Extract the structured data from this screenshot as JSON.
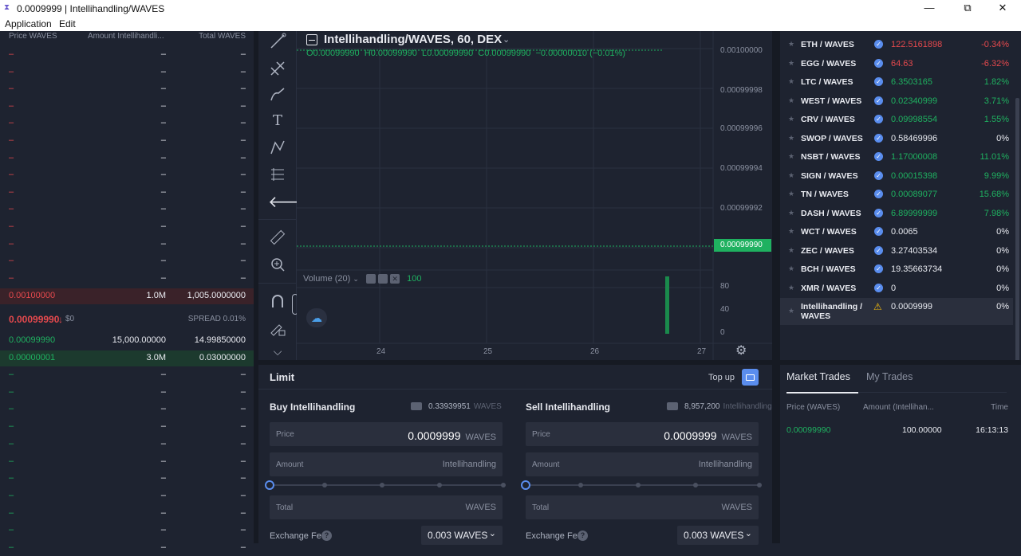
{
  "window": {
    "title": "0.0009999 | Intellihandling/WAVES",
    "logo_icon": "waves-logo-icon",
    "minimize": "—",
    "maximize": "⧉",
    "close": "✕"
  },
  "menu": [
    "Application",
    "Edit"
  ],
  "orderbook": {
    "headers": [
      "Price WAVES",
      "Amount Intellihandli...",
      "Total WAVES"
    ],
    "asks_empty": [
      "–",
      "–",
      "–",
      "–",
      "–",
      "–",
      "–",
      "–",
      "–",
      "–",
      "–",
      "–",
      "–",
      "–"
    ],
    "ask": {
      "price": "0.00100000",
      "amount": "1.0M",
      "total": "1,005.0000000"
    },
    "last": {
      "price": "0.00099990",
      "arrow": "↓",
      "usd": "$0",
      "spread": "SPREAD 0.01%"
    },
    "bids": [
      {
        "price": "0.00099990",
        "amount": "15,000.00000",
        "total": "14.99850000"
      },
      {
        "price": "0.00000001",
        "amount": "3.0M",
        "total": "0.03000000"
      }
    ],
    "bids_empty": [
      "–",
      "–",
      "–",
      "–",
      "–",
      "–",
      "–",
      "–",
      "–",
      "–",
      "–"
    ]
  },
  "chart": {
    "title": "Intellihandling/WAVES, 60, DEX",
    "ohlc": "O0.00099990  H0.00099990  L0.00099990  C0.00099990  −0.00000010 (−0.01%)",
    "y_ticks": [
      "0.00100000",
      "0.00099998",
      "0.00099996",
      "0.00099994",
      "0.00099992"
    ],
    "last_price_tag": "0.00099990",
    "volume_label": "Volume (20)",
    "volume_value": "100",
    "vol_ticks": [
      "80",
      "40",
      "0"
    ],
    "x_ticks": [
      "24",
      "25",
      "26",
      "27"
    ],
    "colors": {
      "up": "#1fb160",
      "tag": "#1fb160"
    }
  },
  "markets": [
    {
      "pair": "ETH / WAVES",
      "price": "122.5161898",
      "change": "-0.34%",
      "pc": "red",
      "cc": "red"
    },
    {
      "pair": "EGG / WAVES",
      "price": "64.63",
      "change": "-6.32%",
      "pc": "red",
      "cc": "red"
    },
    {
      "pair": "LTC / WAVES",
      "price": "6.3503165",
      "change": "1.82%",
      "pc": "grn",
      "cc": "grn"
    },
    {
      "pair": "WEST / WAVES",
      "price": "0.02340999",
      "change": "3.71%",
      "pc": "grn",
      "cc": "grn"
    },
    {
      "pair": "CRV / WAVES",
      "price": "0.09998554",
      "change": "1.55%",
      "pc": "grn",
      "cc": "grn"
    },
    {
      "pair": "SWOP / WAVES",
      "price": "0.58469996",
      "change": "0%",
      "pc": "wht",
      "cc": "wht"
    },
    {
      "pair": "NSBT / WAVES",
      "price": "1.17000008",
      "change": "11.01%",
      "pc": "grn",
      "cc": "grn"
    },
    {
      "pair": "SIGN / WAVES",
      "price": "0.00015398",
      "change": "9.99%",
      "pc": "grn",
      "cc": "grn"
    },
    {
      "pair": "TN / WAVES",
      "price": "0.00089077",
      "change": "15.68%",
      "pc": "grn",
      "cc": "grn"
    },
    {
      "pair": "DASH / WAVES",
      "price": "6.89999999",
      "change": "7.98%",
      "pc": "grn",
      "cc": "grn"
    },
    {
      "pair": "WCT / WAVES",
      "price": "0.0065",
      "change": "0%",
      "pc": "wht",
      "cc": "wht"
    },
    {
      "pair": "ZEC / WAVES",
      "price": "3.27403534",
      "change": "0%",
      "pc": "wht",
      "cc": "wht"
    },
    {
      "pair": "BCH / WAVES",
      "price": "19.35663734",
      "change": "0%",
      "pc": "wht",
      "cc": "wht"
    },
    {
      "pair": "XMR / WAVES",
      "price": "0",
      "change": "0%",
      "pc": "wht",
      "cc": "wht"
    }
  ],
  "selected_market": {
    "pair_line1": "Intellihandling /",
    "pair_line2": "WAVES",
    "price": "0.0009999",
    "change": "0%"
  },
  "order": {
    "tab": "Limit",
    "topup": "Top up",
    "buy": {
      "title": "Buy Intellihandling",
      "balance": "0.33939951",
      "balance_unit": "WAVES",
      "price_label": "Price",
      "price": "0.0009999",
      "price_unit": "WAVES",
      "amount_label": "Amount",
      "amount_unit": "Intellihandling",
      "total_label": "Total",
      "total_unit": "WAVES",
      "fee_label": "Exchange Fee",
      "fee": "0.003 WAVES"
    },
    "sell": {
      "title": "Sell Intellihandling",
      "balance": "8,957,200",
      "balance_unit": "Intellihandling",
      "price_label": "Price",
      "price": "0.0009999",
      "price_unit": "WAVES",
      "amount_label": "Amount",
      "amount_unit": "Intellihandling",
      "total_label": "Total",
      "total_unit": "WAVES",
      "fee_label": "Exchange Fee",
      "fee": "0.003 WAVES"
    }
  },
  "trades": {
    "tabs": [
      "Market Trades",
      "My Trades"
    ],
    "headers": [
      "Price (WAVES)",
      "Amount (Intellihan...",
      "Time"
    ],
    "rows": [
      {
        "price": "0.00099990",
        "amount": "100.00000",
        "time": "16:13:13"
      }
    ]
  }
}
